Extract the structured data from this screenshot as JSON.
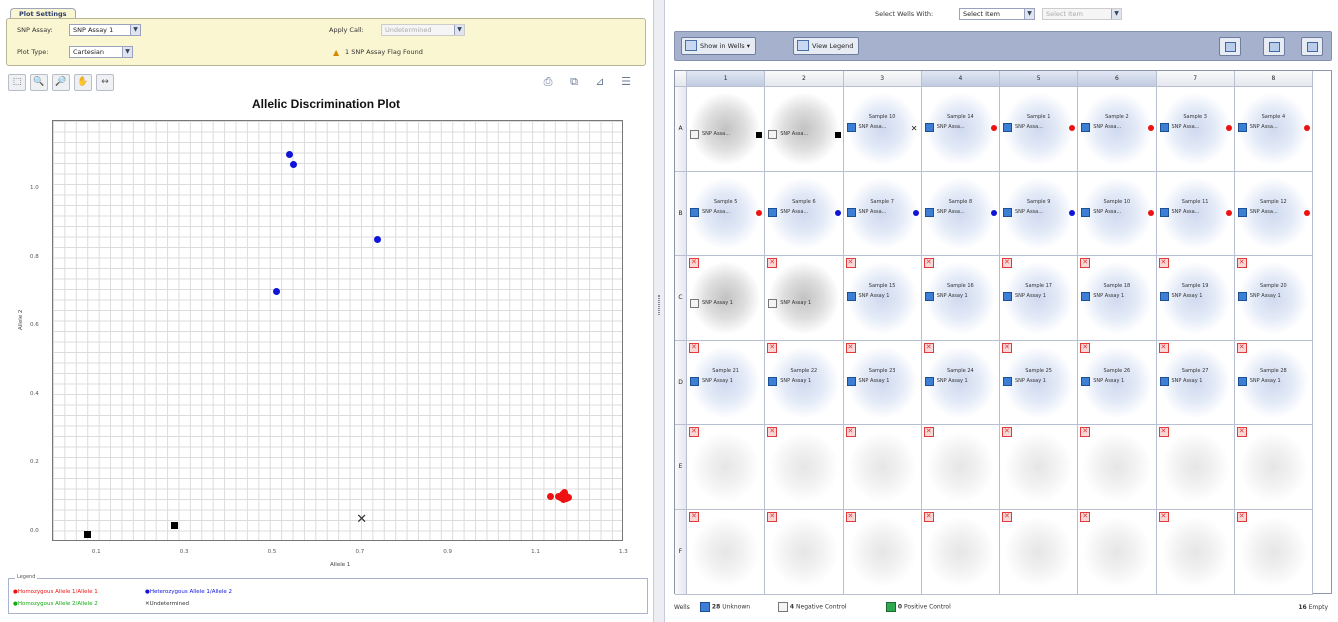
{
  "plot_settings": {
    "tab": "Plot Settings",
    "snp_assay_label": "SNP Assay:",
    "snp_assay_value": "SNP Assay 1",
    "apply_call_label": "Apply Call:",
    "apply_call_value": "Undetermined",
    "plot_type_label": "Plot Type:",
    "plot_type_value": "Cartesian",
    "flag_text": "1 SNP Assay Flag Found"
  },
  "plot_toolbar": {
    "tools": [
      "select-tool",
      "zoom-in-tool",
      "zoom-out-tool",
      "pan-tool",
      "reset-tool"
    ],
    "icons": [
      "print-icon",
      "copy-icon",
      "chart-options-icon",
      "columns-icon"
    ]
  },
  "chart_data": {
    "type": "scatter",
    "title": "Allelic Discrimination Plot",
    "xlabel": "Allele 1",
    "ylabel": "Allele 2",
    "xlim": [
      0.0,
      1.3
    ],
    "ylim": [
      -0.03,
      1.2
    ],
    "xticks": [
      "0.1",
      "0.3",
      "0.5",
      "0.7",
      "0.9",
      "1.1",
      "1.3"
    ],
    "yticks": [
      "0.0",
      "0.2",
      "0.4",
      "0.6",
      "0.8",
      "1.0"
    ],
    "grid": true,
    "series": [
      {
        "name": "Homozygous Allele 1/Allele 1",
        "color": "#ee1111",
        "marker": "circle",
        "points": [
          [
            1.135,
            0.1
          ],
          [
            1.153,
            0.1
          ],
          [
            1.158,
            0.096
          ],
          [
            1.162,
            0.107
          ],
          [
            1.165,
            0.09
          ],
          [
            1.168,
            0.1
          ],
          [
            1.17,
            0.104
          ],
          [
            1.172,
            0.094
          ],
          [
            1.166,
            0.112
          ],
          [
            1.175,
            0.098
          ]
        ]
      },
      {
        "name": "Heterozygous Allele 1/Allele 2",
        "color": "#1014d8",
        "marker": "circle",
        "points": [
          [
            0.51,
            0.7
          ],
          [
            0.54,
            1.1
          ],
          [
            0.55,
            1.07
          ],
          [
            0.74,
            0.85
          ]
        ]
      },
      {
        "name": "Homozygous Allele 2/Allele 2",
        "color": "#11aa11",
        "marker": "circle",
        "points": []
      },
      {
        "name": "Undetermined",
        "color": "#000000",
        "marker": "x",
        "points": [
          [
            0.705,
            0.03
          ]
        ]
      },
      {
        "name": "No Template Control",
        "color": "#000000",
        "marker": "square",
        "points": [
          [
            0.08,
            -0.01
          ],
          [
            0.28,
            0.015
          ]
        ]
      }
    ]
  },
  "legend": {
    "title": "Legend",
    "items": [
      {
        "label": "Homozygous Allele 1/Allele 1",
        "color": "#ee1111"
      },
      {
        "label": "Heterozygous Allele 1/Allele 2",
        "color": "#1014d8"
      },
      {
        "label": "Homozygous Allele 2/Allele 2",
        "color": "#11aa11"
      },
      {
        "label": "Undetermined",
        "color": "#000000"
      }
    ]
  },
  "select_wells": {
    "label": "Select Wells With:",
    "value1": "Select Item",
    "value2": "Select Item"
  },
  "plate_toolbar": {
    "show_in_wells": "Show in Wells",
    "view_legend": "View Legend"
  },
  "plate": {
    "columns": [
      "1",
      "2",
      "3",
      "4",
      "5",
      "6",
      "7",
      "8"
    ],
    "rows": [
      "A",
      "B",
      "C",
      "D",
      "E",
      "F"
    ],
    "highlight_cols": [
      0,
      3,
      4,
      5
    ],
    "wells": [
      [
        {
          "kind": "neg",
          "assay": "SNP Assa...",
          "call": "sq"
        },
        {
          "kind": "neg",
          "assay": "SNP Assa...",
          "call": "sq"
        },
        {
          "kind": "unk",
          "name": "Sample 10",
          "assay": "SNP Assa...",
          "call": "x"
        },
        {
          "kind": "unk",
          "name": "Sample 14",
          "assay": "SNP Assa...",
          "call": "red"
        },
        {
          "kind": "unk",
          "name": "Sample 1",
          "assay": "SNP Assa...",
          "call": "red"
        },
        {
          "kind": "unk",
          "name": "Sample 2",
          "assay": "SNP Assa...",
          "call": "red"
        },
        {
          "kind": "unk",
          "name": "Sample 3",
          "assay": "SNP Assa...",
          "call": "red"
        },
        {
          "kind": "unk",
          "name": "Sample 4",
          "assay": "SNP Assa...",
          "call": "red"
        }
      ],
      [
        {
          "kind": "unk",
          "name": "Sample 5",
          "assay": "SNP Assa...",
          "call": "red"
        },
        {
          "kind": "unk",
          "name": "Sample 6",
          "assay": "SNP Assa...",
          "call": "blue"
        },
        {
          "kind": "unk",
          "name": "Sample 7",
          "assay": "SNP Assa...",
          "call": "blue"
        },
        {
          "kind": "unk",
          "name": "Sample 8",
          "assay": "SNP Assa...",
          "call": "blue"
        },
        {
          "kind": "unk",
          "name": "Sample 9",
          "assay": "SNP Assa...",
          "call": "blue"
        },
        {
          "kind": "unk",
          "name": "Sample 10",
          "assay": "SNP Assa...",
          "call": "red"
        },
        {
          "kind": "unk",
          "name": "Sample 11",
          "assay": "SNP Assa...",
          "call": "red"
        },
        {
          "kind": "unk",
          "name": "Sample 12",
          "assay": "SNP Assa...",
          "call": "red"
        }
      ],
      [
        {
          "kind": "neg",
          "assay": "SNP Assay 1",
          "flag": true
        },
        {
          "kind": "neg",
          "assay": "SNP Assay 1",
          "flag": true
        },
        {
          "kind": "unk",
          "name": "Sample 15",
          "assay": "SNP Assay 1",
          "flag": true
        },
        {
          "kind": "unk",
          "name": "Sample 16",
          "assay": "SNP Assay 1",
          "flag": true
        },
        {
          "kind": "unk",
          "name": "Sample 17",
          "assay": "SNP Assay 1",
          "flag": true
        },
        {
          "kind": "unk",
          "name": "Sample 18",
          "assay": "SNP Assay 1",
          "flag": true
        },
        {
          "kind": "unk",
          "name": "Sample 19",
          "assay": "SNP Assay 1",
          "flag": true
        },
        {
          "kind": "unk",
          "name": "Sample 20",
          "assay": "SNP Assay 1",
          "flag": true
        }
      ],
      [
        {
          "kind": "unk",
          "name": "Sample 21",
          "assay": "SNP Assay 1",
          "flag": true
        },
        {
          "kind": "unk",
          "name": "Sample 22",
          "assay": "SNP Assay 1",
          "flag": true
        },
        {
          "kind": "unk",
          "name": "Sample 23",
          "assay": "SNP Assay 1",
          "flag": true
        },
        {
          "kind": "unk",
          "name": "Sample 24",
          "assay": "SNP Assay 1",
          "flag": true
        },
        {
          "kind": "unk",
          "name": "Sample 25",
          "assay": "SNP Assay 1",
          "flag": true
        },
        {
          "kind": "unk",
          "name": "Sample 26",
          "assay": "SNP Assay 1",
          "flag": true
        },
        {
          "kind": "unk",
          "name": "Sample 27",
          "assay": "SNP Assay 1",
          "flag": true
        },
        {
          "kind": "unk",
          "name": "Sample 28",
          "assay": "SNP Assay 1",
          "flag": true
        }
      ],
      [
        {
          "kind": "empty",
          "flag": true
        },
        {
          "kind": "empty",
          "flag": true
        },
        {
          "kind": "empty",
          "flag": true
        },
        {
          "kind": "empty",
          "flag": true
        },
        {
          "kind": "empty",
          "flag": true
        },
        {
          "kind": "empty",
          "flag": true
        },
        {
          "kind": "empty",
          "flag": true
        },
        {
          "kind": "empty",
          "flag": true
        }
      ],
      [
        {
          "kind": "empty",
          "flag": true
        },
        {
          "kind": "empty",
          "flag": true
        },
        {
          "kind": "empty",
          "flag": true
        },
        {
          "kind": "empty",
          "flag": true
        },
        {
          "kind": "empty",
          "flag": true
        },
        {
          "kind": "empty",
          "flag": true
        },
        {
          "kind": "empty",
          "flag": true
        },
        {
          "kind": "empty",
          "flag": true
        }
      ]
    ]
  },
  "status": {
    "wells_label": "Wells",
    "unknown_count": "28",
    "unknown_label": "Unknown",
    "negative_count": "4",
    "negative_label": "Negative Control",
    "positive_count": "0",
    "positive_label": "Positive Control",
    "empty_count": "16",
    "empty_label": "Empty"
  }
}
